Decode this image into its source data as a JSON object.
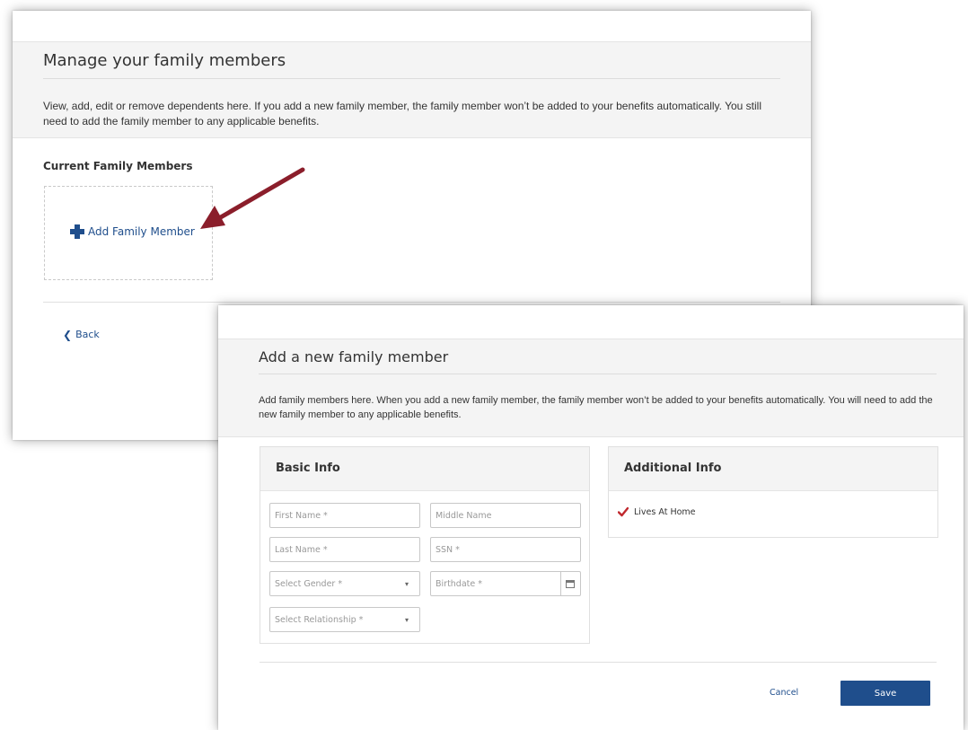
{
  "manage_panel": {
    "title": "Manage your family members",
    "description": "View, add, edit or remove dependents here. If you add a new family member, the family member won’t be added to your benefits automatically. You still need to add the family member to any applicable benefits.",
    "current_heading": "Current Family Members",
    "add_label": "Add Family Member",
    "back_label": "Back"
  },
  "add_panel": {
    "title": "Add a new family member",
    "description": "Add family members here. When you add a new family member, the family member won’t be added to your benefits automatically. You will need to add the new family member to any applicable benefits.",
    "basic_info": {
      "title": "Basic Info",
      "first_name_placeholder": "First Name *",
      "middle_name_placeholder": "Middle Name",
      "last_name_placeholder": "Last Name *",
      "ssn_placeholder": "SSN *",
      "gender_placeholder": "Select Gender *",
      "birthdate_placeholder": "Birthdate *",
      "relationship_placeholder": "Select Relationship *"
    },
    "additional_info": {
      "title": "Additional Info",
      "lives_at_home_label": "Lives At Home",
      "lives_at_home_checked": true
    },
    "cancel_label": "Cancel",
    "save_label": "Save"
  },
  "icons": {
    "add": "plus-icon",
    "back": "chevron-left-icon",
    "dropdown": "chevron-down-icon",
    "date": "calendar-icon",
    "checked": "check-icon",
    "annotation": "arrow-icon"
  },
  "colors": {
    "link": "#1f4e8c",
    "primary_button": "#1f4e8c",
    "checkmark": "#c0282d",
    "annotation_arrow": "#8b1e2b",
    "header_bg": "#f4f4f4"
  }
}
